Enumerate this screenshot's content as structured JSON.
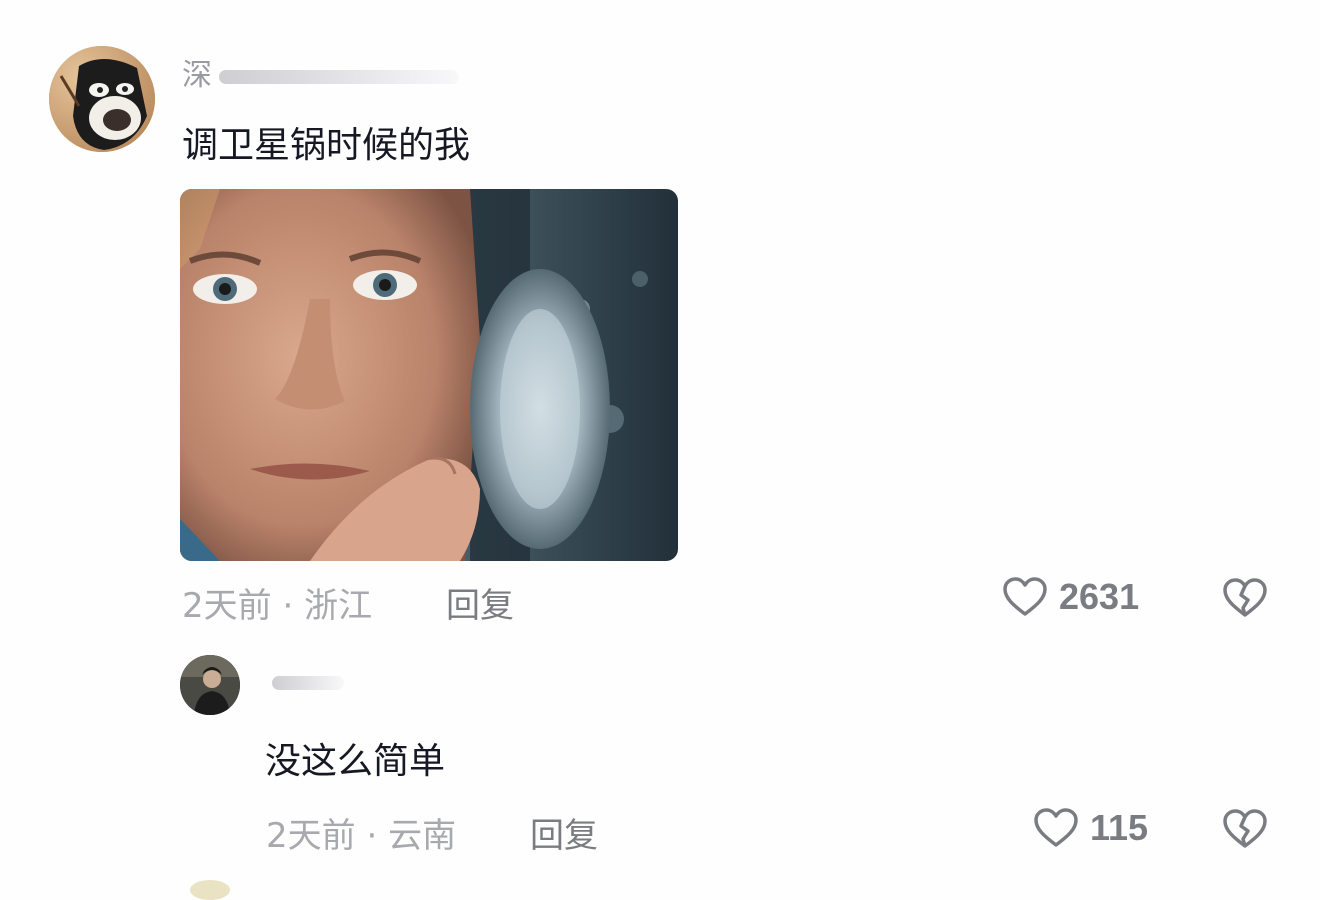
{
  "comments": [
    {
      "username": "深",
      "text": "调卫星锅时候的我",
      "time": "2天前",
      "location": "浙江",
      "meta_separator": " · ",
      "reply_label": "回复",
      "likes": "2631",
      "has_image": true
    }
  ],
  "replies": [
    {
      "username": "",
      "text": "没这么简单",
      "time": "2天前",
      "location": "云南",
      "meta_separator": " · ",
      "reply_label": "回复",
      "likes": "115"
    }
  ],
  "icons": {
    "like": "heart-outline-icon",
    "dislike": "broken-heart-icon"
  },
  "colors": {
    "text_primary": "#161823",
    "text_secondary": "#a8a9ae",
    "action_gray": "#7b7c82",
    "background": "#fefefe"
  }
}
